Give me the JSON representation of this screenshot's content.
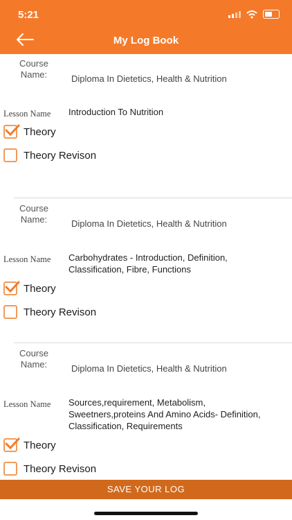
{
  "status": {
    "time": "5:21"
  },
  "header": {
    "title": "My Log Book"
  },
  "labels": {
    "course": "Course Name:",
    "lesson": "Lesson Name"
  },
  "entries": [
    {
      "course": "Diploma In Dietetics, Health & Nutrition",
      "lesson": "Introduction To Nutrition",
      "options": [
        {
          "label": "Theory",
          "checked": true
        },
        {
          "label": "Theory Revison",
          "checked": false
        }
      ]
    },
    {
      "course": "Diploma In Dietetics, Health & Nutrition",
      "lesson": "Carbohydrates - Introduction, Definition, Classification, Fibre, Functions",
      "options": [
        {
          "label": "Theory",
          "checked": true
        },
        {
          "label": "Theory Revison",
          "checked": false
        }
      ]
    },
    {
      "course": "Diploma In Dietetics, Health & Nutrition",
      "lesson": "Sources,requirement, Metabolism, Sweetners,proteins And Amino Acids- Definition, Classification, Requirements",
      "options": [
        {
          "label": "Theory",
          "checked": true
        },
        {
          "label": "Theory Revison",
          "checked": false
        }
      ]
    }
  ],
  "footer": {
    "save_label": "SAVE YOUR LOG"
  },
  "colors": {
    "accent": "#f47a2a",
    "save": "#d1691d",
    "checkbox": "#f39a58"
  }
}
